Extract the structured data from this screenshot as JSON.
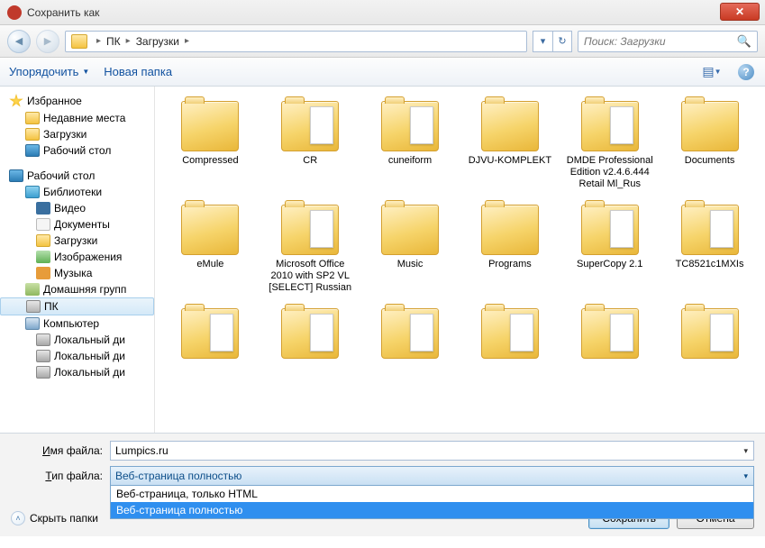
{
  "window": {
    "title": "Сохранить как"
  },
  "nav": {
    "crumbs": [
      "ПК",
      "Загрузки"
    ],
    "search_placeholder": "Поиск: Загрузки"
  },
  "toolbar": {
    "organize": "Упорядочить",
    "new_folder": "Новая папка"
  },
  "sidebar": {
    "favorites": "Избранное",
    "fav_items": [
      "Недавние места",
      "Загрузки",
      "Рабочий стол"
    ],
    "desktop": "Рабочий стол",
    "libs": "Библиотеки",
    "lib_items": [
      "Видео",
      "Документы",
      "Загрузки",
      "Изображения",
      "Музыка"
    ],
    "homegroup": "Домашняя групп",
    "pc": "ПК",
    "computer": "Компьютер",
    "disks": [
      "Локальный ди",
      "Локальный ди",
      "Локальный ди"
    ]
  },
  "files": [
    "Compressed",
    "CR",
    "cuneiform",
    "DJVU-KOMPLEKT",
    "DMDE Professional Edition v2.4.6.444 Retail Ml_Rus",
    "Documents",
    "eMule",
    "Microsoft Office 2010 with SP2 VL [SELECT] Russian",
    "Music",
    "Programs",
    "SuperCopy 2.1",
    "TC8521c1MXIs",
    "",
    "",
    "",
    "",
    "",
    ""
  ],
  "form": {
    "filename_label_pre": "Имя файла:",
    "filename_value": "Lumpics.ru",
    "filetype_label_pre": "Тип файла:",
    "filetype_selected": "Веб-страница полностью",
    "options": [
      "Веб-страница, только HTML",
      "Веб-страница полностью"
    ]
  },
  "actions": {
    "hide": "Скрыть папки",
    "save": "Сохранить",
    "cancel": "Отмена"
  }
}
